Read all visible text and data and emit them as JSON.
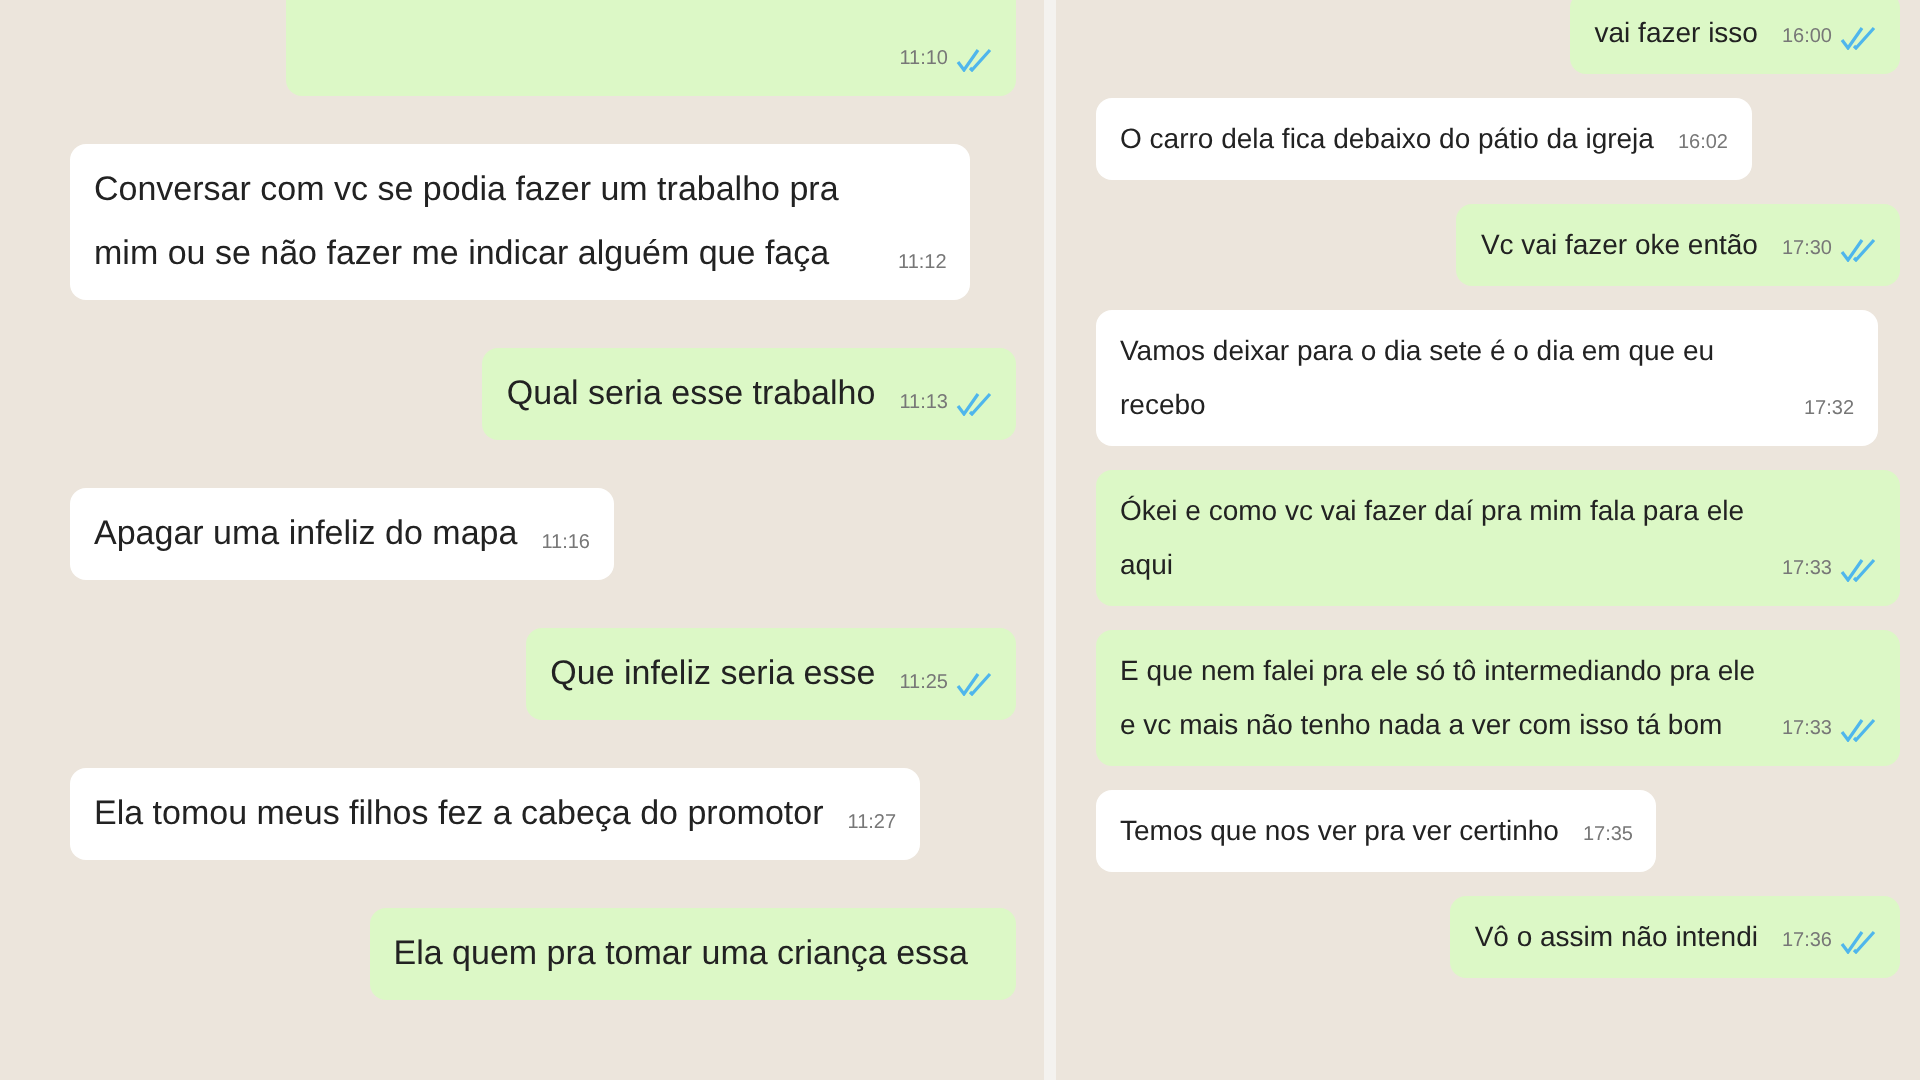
{
  "panels": [
    {
      "messages": [
        {
          "kind": "sent",
          "time": "11:10",
          "read": true
        },
        {
          "kind": "received",
          "text": "Conversar com vc se podia fazer um trabalho pra mim ou se não fazer me indicar alguém que faça",
          "time": "11:12"
        },
        {
          "kind": "sent",
          "text": "Qual seria esse trabalho",
          "time": "11:13",
          "read": true
        },
        {
          "kind": "received",
          "text": "Apagar uma infeliz do mapa",
          "time": "11:16"
        },
        {
          "kind": "sent",
          "text": "Que infeliz seria esse",
          "time": "11:25",
          "read": true
        },
        {
          "kind": "received",
          "text": "Ela tomou meus filhos fez a cabeça do promotor",
          "time": "11:27"
        },
        {
          "kind": "sent",
          "text": "Ela quem pra tomar uma criança essa"
        }
      ]
    },
    {
      "messages": [
        {
          "kind": "sent",
          "text": "vai fazer isso",
          "time": "16:00",
          "read": true
        },
        {
          "kind": "received",
          "text": "O carro dela fica debaixo do pátio da igreja",
          "time": "16:02"
        },
        {
          "kind": "sent",
          "text": "Vc vai fazer oke então",
          "time": "17:30",
          "read": true
        },
        {
          "kind": "received",
          "text": "Vamos deixar para o dia sete é o dia em que eu recebo",
          "time": "17:32"
        },
        {
          "kind": "sent",
          "text": "Ókei e como vc vai fazer daí pra mim fala para ele aqui",
          "time": "17:33",
          "read": true
        },
        {
          "kind": "sent",
          "text": "E que nem falei pra ele só tô intermediando pra ele e vc mais não tenho nada a ver com isso tá bom",
          "time": "17:33",
          "read": true
        },
        {
          "kind": "received",
          "text": "Temos que nos ver pra ver certinho",
          "time": "17:35"
        },
        {
          "kind": "sent",
          "text": "Vô o assim não intendi",
          "time": "17:36",
          "read": true
        }
      ]
    }
  ]
}
